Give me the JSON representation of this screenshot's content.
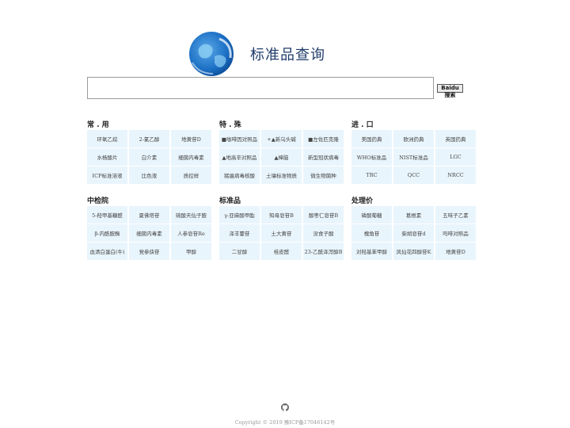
{
  "header": {
    "title": "标准品查询",
    "logo_icon": "globe-logo-icon"
  },
  "search": {
    "value": "",
    "placeholder": "",
    "button_label": "Baidu 搜索"
  },
  "sections": [
    {
      "title": "常 . 用",
      "items": [
        "环氧乙烷",
        "2-氯乙醇",
        "地黄苷D",
        "水杨酸片",
        "白介素",
        "细菌内毒素",
        "ICP标准溶液",
        "比色液",
        "质控样"
      ]
    },
    {
      "title": "特 . 殊",
      "items": [
        "■咖啡因对照品",
        "+▲新乌头碱",
        "■左佐匹克隆",
        "▲地高辛对照品",
        "▲樟脑",
        "新型冠状病毒",
        "猪瘟病毒核酸",
        "土壤标准物质",
        "微生物菌种"
      ]
    },
    {
      "title": "进 . 口",
      "items": [
        "美国药典",
        "欧洲药典",
        "英国药典",
        "WHO标准品",
        "NIST标准品",
        "LGC",
        "TRC",
        "QCC",
        "NRCC"
      ]
    },
    {
      "title": "中检院",
      "items": [
        "5-羟甲基糠醛",
        "夏佛塔苷",
        "硫酸天仙子胺",
        "β-内酰胺酶",
        "细菌内毒素",
        "人参皂苷Re",
        "血清白蛋白(牛)",
        "党参炔苷",
        "甲醇"
      ]
    },
    {
      "title": "标准品",
      "items": [
        "γ-亚麻酸甲酯",
        "知母皂苷B",
        "酸枣仁皂苷B",
        "泽羊藿苷",
        "土大黄苷",
        "没食子酸",
        "二甘醇",
        "桂皮醛",
        "23-乙酰泽泻醇B"
      ]
    },
    {
      "title": "处理价",
      "items": [
        "磷酸葡糖",
        "葛根素",
        "五味子乙素",
        "槐角苷",
        "柴胡皂苷d",
        "吗啡对照品",
        "对羟基苯甲醇",
        "风仙花四醇苷K",
        "地黄苷D"
      ]
    }
  ],
  "footer": {
    "icon": "github-icon",
    "copyright": "Copyright © 2019 豫ICP备17046142号"
  },
  "colors": {
    "cell_bg": "#e9f5fc",
    "title": "#1f3c6b"
  }
}
